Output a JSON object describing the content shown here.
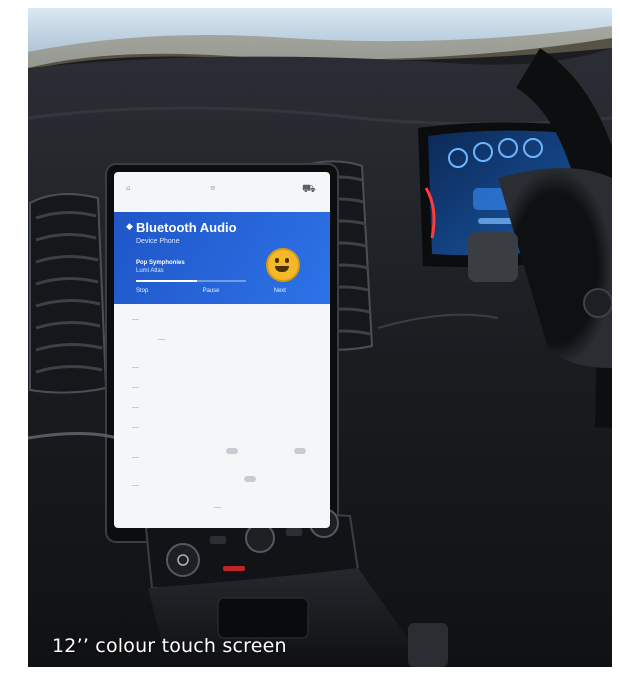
{
  "caption": "12’’ colour touch screen",
  "screen": {
    "app_title": "Bluetooth Audio",
    "source": "Device Phone",
    "track_title": "Pop Symphonies",
    "track_artist": "Lumi Atlas",
    "progress_fraction": 0.55,
    "card_buttons": [
      "Stop",
      "Pause",
      "Next"
    ],
    "emoji_icon": "smiley-face-icon",
    "accent_color": "#2d73e8"
  },
  "colors": {
    "dashboard": "#1b1d21",
    "screen_blue": "#1f56c8",
    "cluster_blue": "#3a8dff",
    "red_button": "#c0242b"
  }
}
